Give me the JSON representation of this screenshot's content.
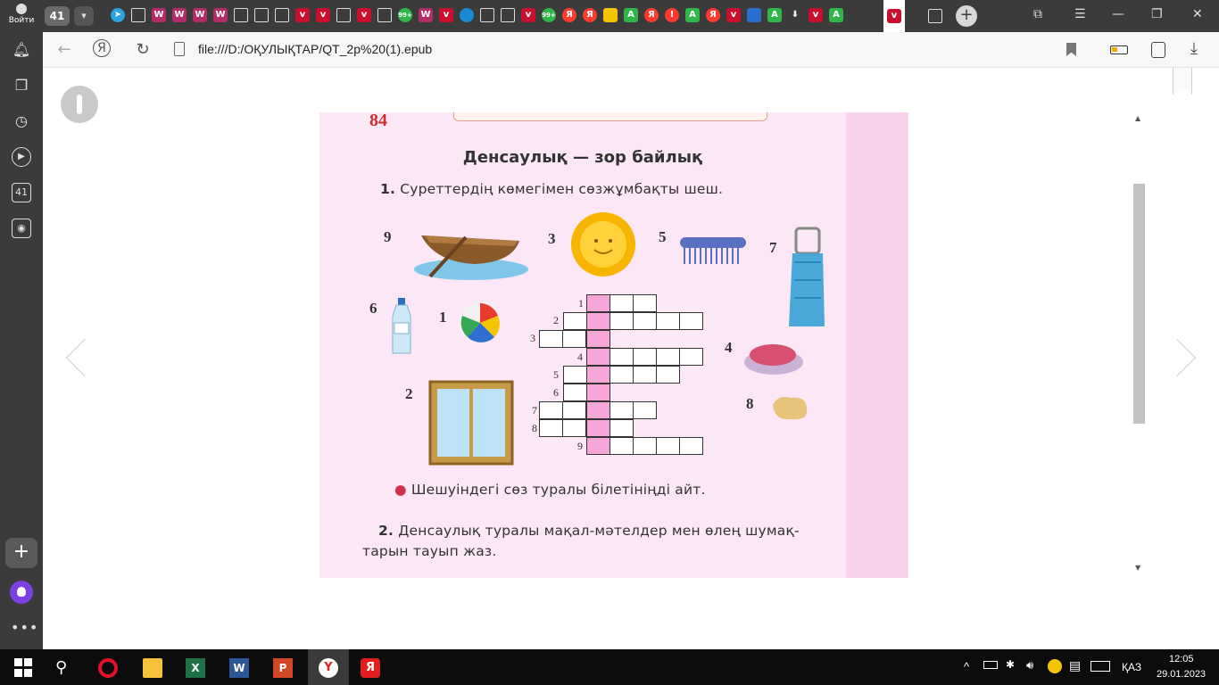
{
  "browser": {
    "login_label": "Войти",
    "tab_count": "41",
    "url": "file:///D:/ОҚУЛЫҚТАР/QT_2p%20(1).epub",
    "tab_icon_names": [
      "telegram-icon",
      "doc-icon",
      "magazine-icon",
      "magazine-icon",
      "magazine-icon",
      "magazine-icon",
      "doc-icon",
      "doc-icon",
      "doc-icon",
      "red-v-icon",
      "red-v-icon",
      "doc-icon",
      "red-v-icon",
      "doc-icon",
      "badge-99-icon",
      "magazine-icon",
      "red-v-icon",
      "globe-icon",
      "doc-icon",
      "doc-icon",
      "red-v-icon",
      "badge-99-icon",
      "yandex-icon",
      "yandex-icon",
      "doc-icon",
      "green-a-icon",
      "yandex-icon",
      "alert-icon",
      "green-a-icon",
      "yandex-icon",
      "red-v-icon",
      "download-icon",
      "red-v-icon",
      "green-a-icon",
      "active-red-v-icon",
      "doc-icon"
    ],
    "tab_icon_labels": {
      "badge": "99+",
      "ya": "Я",
      "a": "A",
      "alert": "!"
    }
  },
  "sidebar": {
    "tabs_count": "41"
  },
  "page": {
    "page_number": "84",
    "title": "Денсаулық — зор байлық",
    "task1_num": "1.",
    "task1_text": "Суреттердің көмегімен сөзжұмбақты шеш.",
    "numbers": {
      "boat": "9",
      "sun": "3",
      "comb": "5",
      "towel": "7",
      "bottle": "6",
      "ball": "1",
      "window": "2",
      "soap": "4",
      "sponge": "8"
    },
    "grid_numbers": [
      "1",
      "2",
      "3",
      "4",
      "5",
      "6",
      "7",
      "8",
      "9"
    ],
    "bullet_text": "Шешуіндегі сөз туралы білетініңді айт.",
    "task2_num": "2.",
    "task2_line1": "Денсаулық туралы мақал-мәтелдер мен өлең шумақ-",
    "task2_line2": "тарын тауып жаз."
  },
  "taskbar": {
    "keyboard_lang": "ҚАЗ",
    "time": "12:05",
    "date": "29.01.2023"
  }
}
